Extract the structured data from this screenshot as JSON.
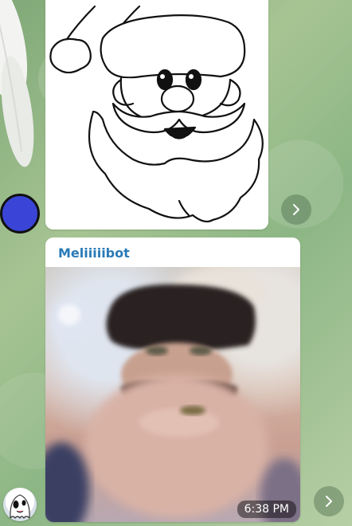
{
  "messages": [
    {
      "type": "image",
      "image_desc": "santa-coloring-outline"
    },
    {
      "type": "bot-photo",
      "sender": "Meliiiiibot",
      "time": "6:38 PM",
      "image_desc": "generated-santa-photo"
    }
  ],
  "colors": {
    "sender_name": "#2a7ab7",
    "avatar_user": "#3a45d8",
    "time_pill_bg": "rgba(0,0,0,0.45)"
  },
  "icons": {
    "forward": "chevron-right-icon"
  }
}
